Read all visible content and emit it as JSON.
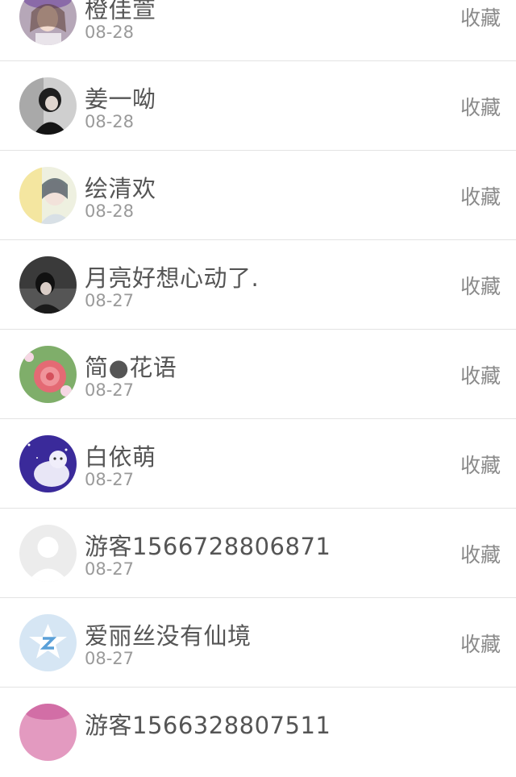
{
  "items": [
    {
      "name": "橙佳萱",
      "date": "08-28",
      "action": "收藏",
      "avatar": "avatar-girl-purple-hat"
    },
    {
      "name": "姜一呦",
      "date": "08-28",
      "action": "收藏",
      "avatar": "avatar-dark-hair-girl"
    },
    {
      "name": "绘清欢",
      "date": "08-28",
      "action": "收藏",
      "avatar": "avatar-girl-light"
    },
    {
      "name": "月亮好想心动了.",
      "date": "08-27",
      "action": "收藏",
      "avatar": "avatar-dark-photo"
    },
    {
      "name": "简●花语",
      "date": "08-27",
      "action": "收藏",
      "avatar": "avatar-pink-rose"
    },
    {
      "name": "白依萌",
      "date": "08-27",
      "action": "收藏",
      "avatar": "avatar-starry-cat"
    },
    {
      "name": "游客1566728806871",
      "date": "08-27",
      "action": "收藏",
      "avatar": "avatar-default-person"
    },
    {
      "name": "爱丽丝没有仙境",
      "date": "08-27",
      "action": "收藏",
      "avatar": "avatar-qzone-star"
    },
    {
      "name": "游客1566328807511",
      "date": "",
      "action": "",
      "avatar": "avatar-pink-partial"
    }
  ]
}
